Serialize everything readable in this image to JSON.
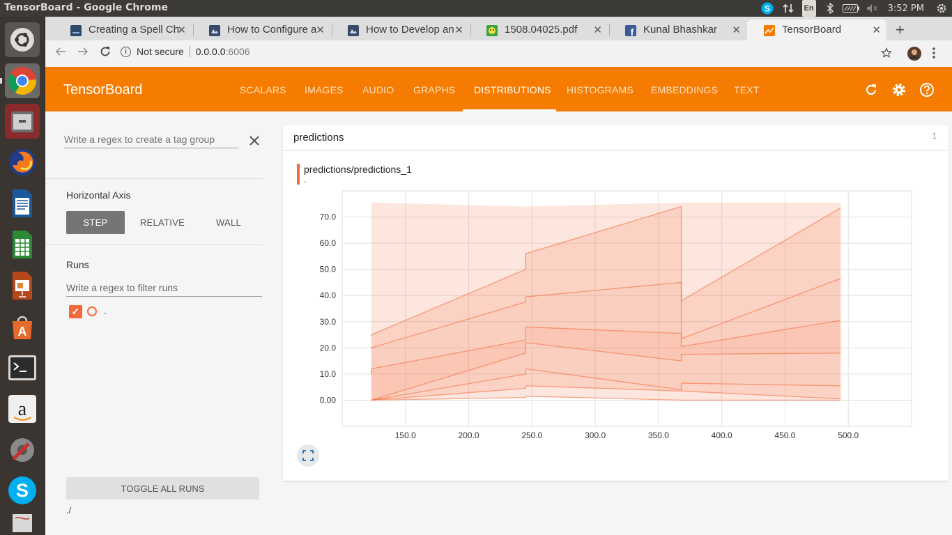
{
  "os": {
    "window_title": "TensorBoard - Google Chrome",
    "lang_badge": "En",
    "clock": "3:52 PM"
  },
  "browser": {
    "tabs": [
      {
        "label": "Creating a Spell Che",
        "active": false
      },
      {
        "label": "How to Configure a",
        "active": false
      },
      {
        "label": "How to Develop an",
        "active": false
      },
      {
        "label": "1508.04025.pdf",
        "active": false
      },
      {
        "label": "Kunal Bhashkar",
        "active": false
      },
      {
        "label": "TensorBoard",
        "active": true
      }
    ],
    "security_label": "Not secure",
    "url_host": "0.0.0.0",
    "url_port": ":6006"
  },
  "tensorboard": {
    "brand": "TensorBoard",
    "nav": [
      "SCALARS",
      "IMAGES",
      "AUDIO",
      "GRAPHS",
      "DISTRIBUTIONS",
      "HISTOGRAMS",
      "EMBEDDINGS",
      "TEXT"
    ],
    "active_nav": "DISTRIBUTIONS"
  },
  "sidebar": {
    "tag_group_placeholder": "Write a regex to create a tag group",
    "horizontal_axis_label": "Horizontal Axis",
    "axis_options": [
      "STEP",
      "RELATIVE",
      "WALL"
    ],
    "axis_selected": "STEP",
    "runs_label": "Runs",
    "runs_filter_placeholder": "Write a regex to filter runs",
    "runs": [
      {
        "name": ".",
        "checked": true
      }
    ],
    "toggle_all_label": "TOGGLE ALL RUNS",
    "logdir": "./"
  },
  "main": {
    "group_name": "predictions",
    "group_count": "1",
    "card_title": "predictions/predictions_1",
    "card_run": "."
  },
  "chart_data": {
    "type": "area",
    "title": "predictions/predictions_1",
    "xlabel": "",
    "ylabel": "",
    "x_ticks": [
      "150.0",
      "200.0",
      "250.0",
      "300.0",
      "350.0",
      "400.0",
      "450.0",
      "500.0"
    ],
    "y_ticks": [
      "0.00",
      "10.0",
      "20.0",
      "30.0",
      "40.0",
      "50.0",
      "60.0",
      "70.0"
    ],
    "xlim": [
      100,
      550
    ],
    "ylim": [
      -10,
      80
    ],
    "color": "#f4693a",
    "x": [
      123,
      123,
      245,
      245,
      368,
      368,
      494
    ],
    "percentiles": {
      "p0": [
        0,
        0,
        1,
        1.5,
        0,
        0,
        0
      ],
      "p7": [
        0,
        0,
        4.5,
        5.5,
        3.5,
        3.5,
        0.5
      ],
      "p16": [
        0,
        0,
        10,
        12,
        4,
        6.5,
        5.5
      ],
      "p31": [
        0,
        0,
        18,
        22,
        15,
        17.5,
        18
      ],
      "p50": [
        10,
        12,
        23,
        28,
        25.5,
        20.5,
        30.5
      ],
      "p69": [
        19.5,
        20,
        37.5,
        39.5,
        45,
        23.5,
        46.5
      ],
      "p84": [
        24.5,
        25,
        50,
        56,
        74,
        38,
        73.5
      ],
      "p93": [
        75.5,
        75.5,
        74,
        74,
        75.5,
        75.5,
        75.5
      ],
      "p100": [
        75.5,
        75.5,
        74,
        74,
        75.5,
        75.5,
        75.5
      ]
    }
  }
}
